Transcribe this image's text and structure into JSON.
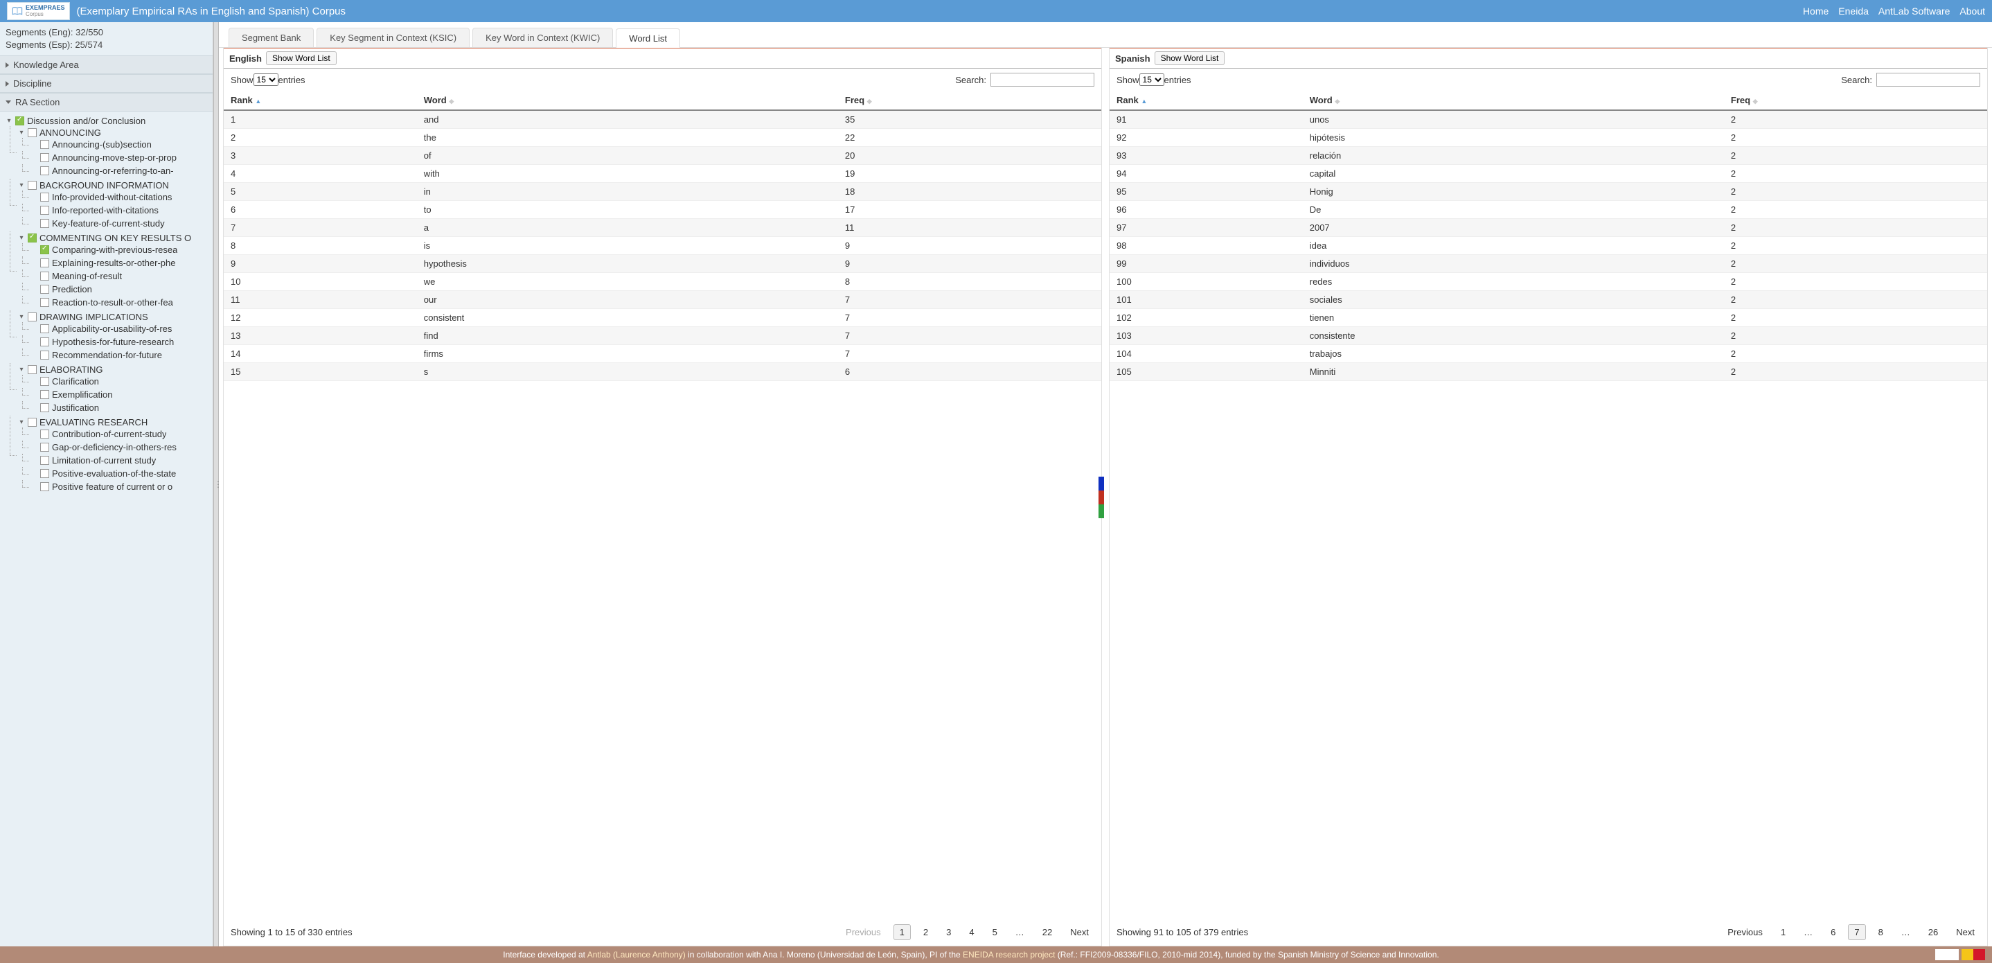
{
  "header": {
    "logo_line1": "EXEMPRAES",
    "logo_line2": "Corpus",
    "title": "(Exemplary Empirical RAs in English and Spanish) Corpus",
    "nav": [
      "Home",
      "Eneida",
      "AntLab Software",
      "About"
    ]
  },
  "sidebar": {
    "seg_eng": "Segments (Eng): 32/550",
    "seg_esp": "Segments (Esp): 25/574",
    "sections": [
      {
        "label": "Knowledge Area",
        "open": false
      },
      {
        "label": "Discipline",
        "open": false
      },
      {
        "label": "RA Section",
        "open": true
      }
    ],
    "tree": {
      "root": {
        "label": "Discussion and/or Conclusion",
        "checked": true,
        "children": [
          {
            "label": "ANNOUNCING",
            "checked": false,
            "children": [
              {
                "label": "Announcing-(sub)section",
                "checked": false
              },
              {
                "label": "Announcing-move-step-or-prop",
                "checked": false
              },
              {
                "label": "Announcing-or-referring-to-an-",
                "checked": false
              }
            ]
          },
          {
            "label": "BACKGROUND INFORMATION",
            "checked": false,
            "children": [
              {
                "label": "Info-provided-without-citations",
                "checked": false
              },
              {
                "label": "Info-reported-with-citations",
                "checked": false
              },
              {
                "label": "Key-feature-of-current-study",
                "checked": false
              }
            ]
          },
          {
            "label": "COMMENTING ON KEY RESULTS O",
            "checked": true,
            "children": [
              {
                "label": "Comparing-with-previous-resea",
                "checked": true
              },
              {
                "label": "Explaining-results-or-other-phe",
                "checked": false
              },
              {
                "label": "Meaning-of-result",
                "checked": false
              },
              {
                "label": "Prediction",
                "checked": false
              },
              {
                "label": "Reaction-to-result-or-other-fea",
                "checked": false
              }
            ]
          },
          {
            "label": "DRAWING IMPLICATIONS",
            "checked": false,
            "children": [
              {
                "label": "Applicability-or-usability-of-res",
                "checked": false
              },
              {
                "label": "Hypothesis-for-future-research",
                "checked": false
              },
              {
                "label": "Recommendation-for-future",
                "checked": false
              }
            ]
          },
          {
            "label": "ELABORATING",
            "checked": false,
            "children": [
              {
                "label": "Clarification",
                "checked": false
              },
              {
                "label": "Exemplification",
                "checked": false
              },
              {
                "label": "Justification",
                "checked": false
              }
            ]
          },
          {
            "label": "EVALUATING RESEARCH",
            "checked": false,
            "children": [
              {
                "label": "Contribution-of-current-study",
                "checked": false
              },
              {
                "label": "Gap-or-deficiency-in-others-res",
                "checked": false
              },
              {
                "label": "Limitation-of-current study",
                "checked": false
              },
              {
                "label": "Positive-evaluation-of-the-state",
                "checked": false
              },
              {
                "label": "Positive feature of current or o",
                "checked": false
              }
            ]
          }
        ]
      }
    }
  },
  "tabs": [
    {
      "label": "Segment Bank",
      "active": false
    },
    {
      "label": "Key Segment in Context (KSIC)",
      "active": false
    },
    {
      "label": "Key Word in Context (KWIC)",
      "active": false
    },
    {
      "label": "Word List",
      "active": true
    }
  ],
  "panes": {
    "english": {
      "lang": "English",
      "button": "Show Word List",
      "show_label_pre": "Show",
      "show_value": "15",
      "show_label_post": "entries",
      "search_label": "Search:",
      "search_value": "",
      "columns": [
        "Rank",
        "Word",
        "Freq"
      ],
      "sort_col": 0,
      "rows": [
        [
          "1",
          "and",
          "35"
        ],
        [
          "2",
          "the",
          "22"
        ],
        [
          "3",
          "of",
          "20"
        ],
        [
          "4",
          "with",
          "19"
        ],
        [
          "5",
          "in",
          "18"
        ],
        [
          "6",
          "to",
          "17"
        ],
        [
          "7",
          "a",
          "11"
        ],
        [
          "8",
          "is",
          "9"
        ],
        [
          "9",
          "hypothesis",
          "9"
        ],
        [
          "10",
          "we",
          "8"
        ],
        [
          "11",
          "our",
          "7"
        ],
        [
          "12",
          "consistent",
          "7"
        ],
        [
          "13",
          "find",
          "7"
        ],
        [
          "14",
          "firms",
          "7"
        ],
        [
          "15",
          "s",
          "6"
        ]
      ],
      "info": "Showing 1 to 15 of 330 entries",
      "pager": {
        "prev": "Previous",
        "next": "Next",
        "pages": [
          "1",
          "2",
          "3",
          "4",
          "5",
          "…",
          "22"
        ],
        "current": "1",
        "prev_disabled": true
      }
    },
    "spanish": {
      "lang": "Spanish",
      "button": "Show Word List",
      "show_label_pre": "Show",
      "show_value": "15",
      "show_label_post": "entries",
      "search_label": "Search:",
      "search_value": "",
      "columns": [
        "Rank",
        "Word",
        "Freq"
      ],
      "sort_col": 0,
      "rows": [
        [
          "91",
          "unos",
          "2"
        ],
        [
          "92",
          "hipótesis",
          "2"
        ],
        [
          "93",
          "relación",
          "2"
        ],
        [
          "94",
          "capital",
          "2"
        ],
        [
          "95",
          "Honig",
          "2"
        ],
        [
          "96",
          "De",
          "2"
        ],
        [
          "97",
          "2007",
          "2"
        ],
        [
          "98",
          "idea",
          "2"
        ],
        [
          "99",
          "individuos",
          "2"
        ],
        [
          "100",
          "redes",
          "2"
        ],
        [
          "101",
          "sociales",
          "2"
        ],
        [
          "102",
          "tienen",
          "2"
        ],
        [
          "103",
          "consistente",
          "2"
        ],
        [
          "104",
          "trabajos",
          "2"
        ],
        [
          "105",
          "Minniti",
          "2"
        ]
      ],
      "info": "Showing 91 to 105 of 379 entries",
      "pager": {
        "prev": "Previous",
        "next": "Next",
        "pages": [
          "1",
          "…",
          "6",
          "7",
          "8",
          "…",
          "26"
        ],
        "current": "7",
        "prev_disabled": false
      }
    }
  },
  "footer": {
    "pre": "Interface developed at ",
    "link1": "Antlab (Laurence Anthony)",
    "mid": " in collaboration with Ana I. Moreno (Universidad de León, Spain), PI of the ",
    "link2": "ENEIDA research project",
    "post": " (Ref.: FFI2009-08336/FILO, 2010-mid 2014), funded by the Spanish Ministry of Science and Innovation."
  }
}
